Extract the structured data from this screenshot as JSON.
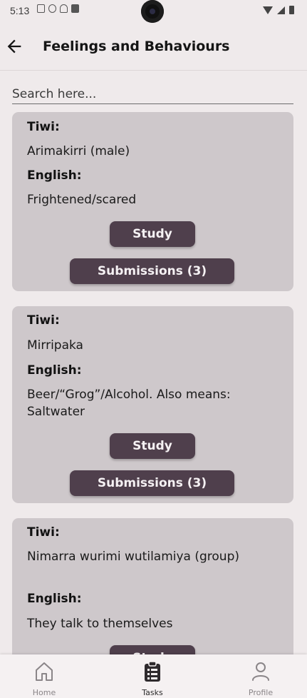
{
  "status_bar": {
    "time": "5:13"
  },
  "header": {
    "title": "Feelings and Behaviours"
  },
  "search": {
    "placeholder": "Search here..."
  },
  "cards": [
    {
      "tiwi_label": "Tiwi:",
      "tiwi_value": "Arimakirri (male)",
      "english_label": "English:",
      "english_value": "Frightened/scared",
      "study_label": "Study",
      "submissions_label": "Submissions (3)"
    },
    {
      "tiwi_label": "Tiwi:",
      "tiwi_value": "Mirripaka",
      "english_label": "English:",
      "english_value": "Beer/“Grog”/Alcohol. Also means: Saltwater",
      "study_label": "Study",
      "submissions_label": "Submissions (3)"
    },
    {
      "tiwi_label": "Tiwi:",
      "tiwi_value": "Nimarra wurimi wutilamiya (group)",
      "english_label": "English:",
      "english_value": "They talk to themselves",
      "study_label": "Study"
    }
  ],
  "bottom_nav": {
    "items": [
      {
        "label": "Home",
        "icon": "home-icon"
      },
      {
        "label": "Tasks",
        "icon": "clipboard-icon",
        "active": true
      },
      {
        "label": "Profile",
        "icon": "person-icon"
      }
    ]
  },
  "colors": {
    "background": "#efeaeb",
    "card": "#cec8cb",
    "button": "#4f3f4c",
    "button_text": "#f5f1f3"
  }
}
